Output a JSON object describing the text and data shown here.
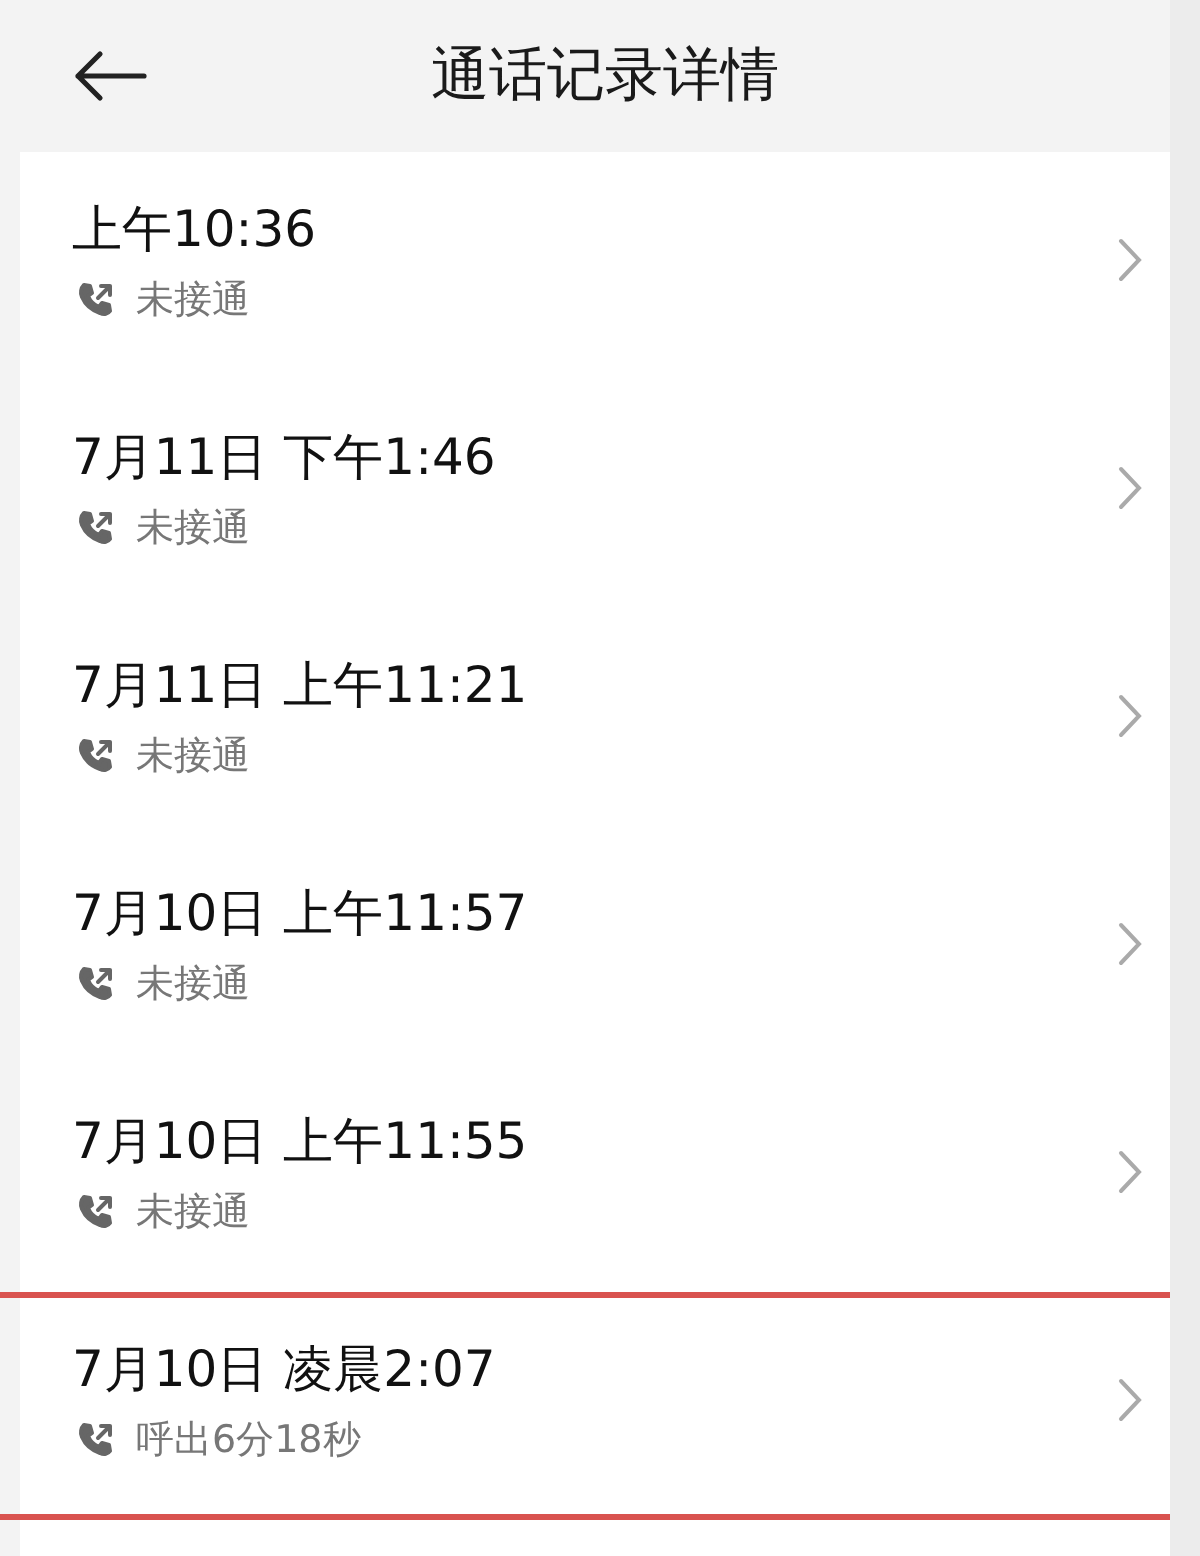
{
  "header": {
    "title": "通话记录详情"
  },
  "calls": [
    {
      "time": "上午10:36",
      "status": "未接通",
      "highlighted": false
    },
    {
      "time": "7月11日 下午1:46",
      "status": "未接通",
      "highlighted": false
    },
    {
      "time": "7月11日 上午11:21",
      "status": "未接通",
      "highlighted": false
    },
    {
      "time": "7月10日 上午11:57",
      "status": "未接通",
      "highlighted": false
    },
    {
      "time": "7月10日 上午11:55",
      "status": "未接通",
      "highlighted": false
    },
    {
      "time": "7月10日 凌晨2:07",
      "status": "呼出6分18秒",
      "highlighted": true
    }
  ]
}
